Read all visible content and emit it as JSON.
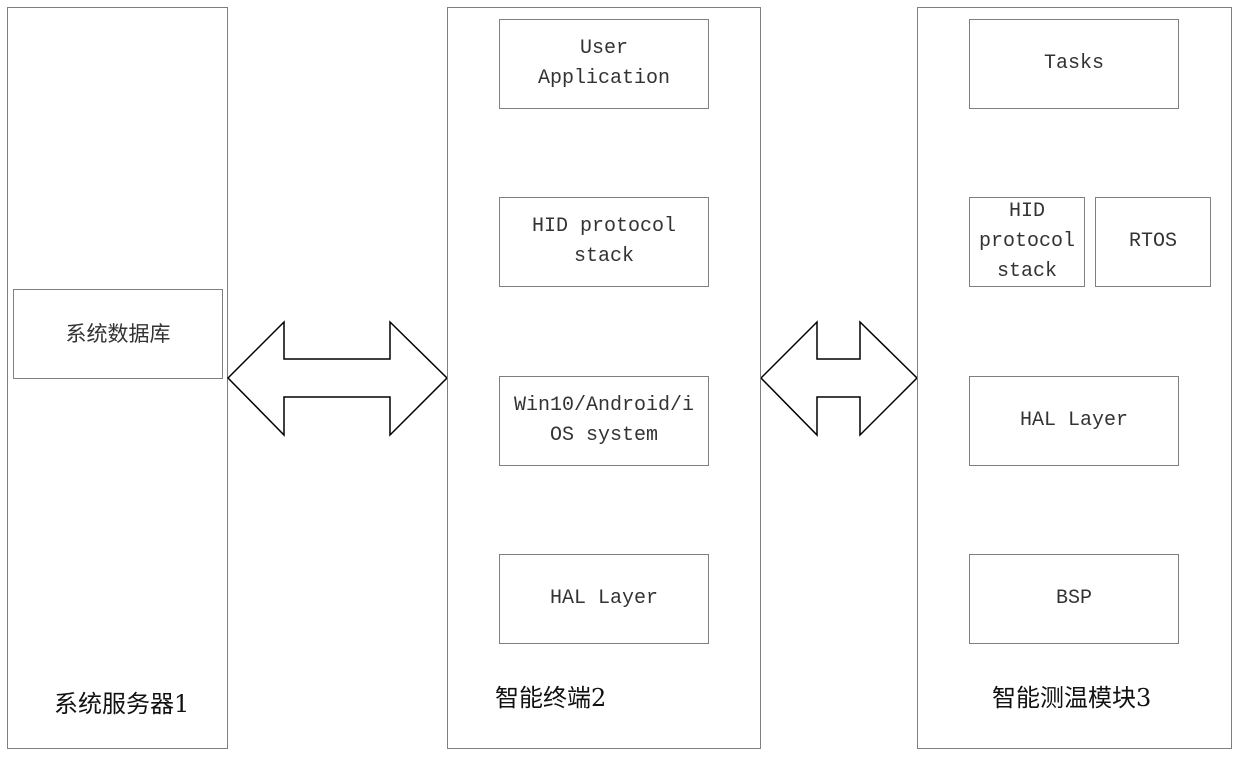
{
  "server": {
    "title": "系统服务器1",
    "database": "系统数据库"
  },
  "terminal": {
    "title": "智能终端2",
    "layers": [
      "User\nApplication",
      "HID protocol\nstack",
      "Win10/Android/i\nOS system",
      "HAL Layer"
    ]
  },
  "module": {
    "title": "智能测温模块3",
    "tasks": "Tasks",
    "hid": "HID\nprotocol\nstack",
    "rtos": "RTOS",
    "hal": "HAL Layer",
    "bsp": "BSP"
  },
  "connections": [
    {
      "from": "系统服务器1",
      "to": "智能终端2",
      "type": "bidirectional"
    },
    {
      "from": "智能终端2",
      "to": "智能测温模块3",
      "type": "bidirectional"
    }
  ],
  "colors": {
    "stroke": "#7f7f7f",
    "arrow_stroke": "#000000",
    "background": "#ffffff"
  }
}
